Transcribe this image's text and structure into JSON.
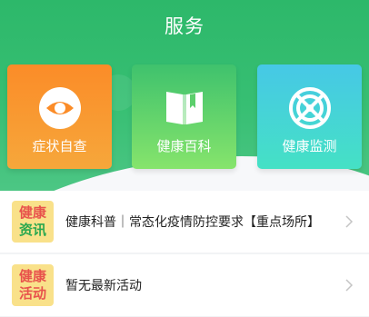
{
  "header": {
    "title": "服务"
  },
  "tiles": [
    {
      "label": "症状自查",
      "icon": "eye-icon"
    },
    {
      "label": "健康百科",
      "icon": "book-icon"
    },
    {
      "label": "健康监测",
      "icon": "monitor-target-icon"
    }
  ],
  "cards": [
    {
      "badge_line1": "健康",
      "badge_line2": "资讯",
      "text": "健康科普｜常态化疫情防控要求【重点场所】",
      "icon": "chevron-right-icon"
    },
    {
      "badge_line1": "健康",
      "badge_line2": "活动",
      "text": "暂无最新活动",
      "icon": "chevron-right-icon"
    }
  ],
  "colors": {
    "header_green": "#37bf73",
    "tile_orange": "#fb8c28",
    "tile_green": "#3fc26d",
    "tile_teal": "#46c8e6"
  }
}
